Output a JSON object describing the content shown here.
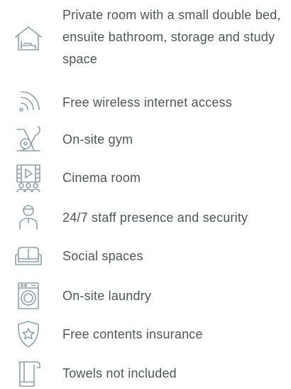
{
  "colors": {
    "text": "#4f5656",
    "icon": "#8fa0a6",
    "background": "#ffffff"
  },
  "amenities": [
    {
      "icon": "house-bed-icon",
      "label": "Private room with a small double bed, ensuite bathroom, storage and study space"
    },
    {
      "icon": "wifi-icon",
      "label": "Free wireless internet access"
    },
    {
      "icon": "exercise-bike-icon",
      "label": "On-site gym"
    },
    {
      "icon": "cinema-icon",
      "label": "Cinema room"
    },
    {
      "icon": "staff-person-icon",
      "label": "24/7 staff presence and security"
    },
    {
      "icon": "sofa-icon",
      "label": "Social spaces"
    },
    {
      "icon": "washing-machine-icon",
      "label": "On-site laundry"
    },
    {
      "icon": "shield-star-icon",
      "label": "Free contents insurance"
    },
    {
      "icon": "towel-icon",
      "label": "Towels not included"
    }
  ]
}
